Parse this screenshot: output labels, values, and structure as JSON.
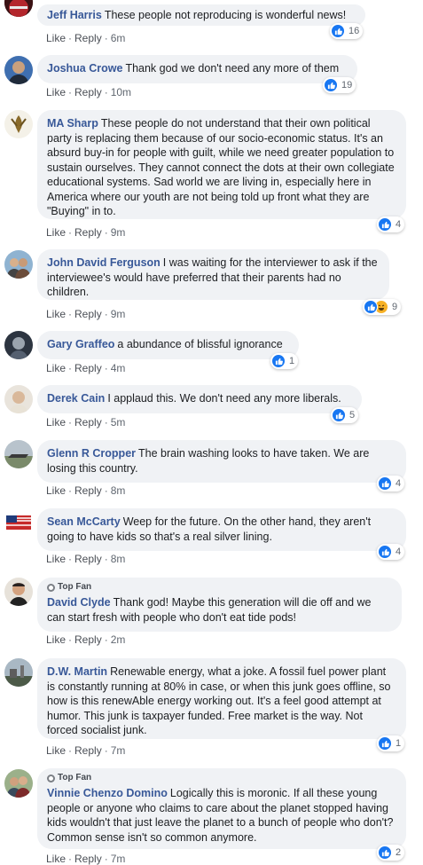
{
  "actions": {
    "like": "Like",
    "reply": "Reply",
    "dot": "·"
  },
  "top_fan_label": "Top Fan",
  "colors": {
    "like_blue": "#1877f2",
    "author_blue": "#385898",
    "bubble_bg": "#f0f2f5",
    "haha_yellow": "#f7b125"
  },
  "comments": [
    {
      "author": "Jeff Harris",
      "text": "These people not reproducing is wonderful news!",
      "time": "6m",
      "reactions": [
        "like-icon"
      ],
      "count": "16"
    },
    {
      "author": "Joshua Crowe",
      "text": "Thank god we don't need any more of them",
      "time": "10m",
      "reactions": [
        "like-icon"
      ],
      "count": "19"
    },
    {
      "author": "MA Sharp",
      "text": "These people do not understand that their own political party is replacing them because of our socio-economic status. It's an absurd buy-in for people with guilt, while we need greater population to sustain ourselves. They cannot connect the dots at their own collegiate educational systems. Sad world we are living in, especially here in America where our youth are not being told up front what they are \"Buying\" in to.",
      "time": "9m",
      "reactions": [
        "like-icon"
      ],
      "count": "4"
    },
    {
      "author": "John David Ferguson",
      "text": "I was waiting for the interviewer to ask if the interviewee's would have preferred that their parents had no children.",
      "time": "9m",
      "reactions": [
        "like-icon",
        "haha-icon"
      ],
      "count": "9"
    },
    {
      "author": "Gary Graffeo",
      "text": "a abundance of blissful ignorance",
      "time": "4m",
      "reactions": [
        "like-icon"
      ],
      "count": "1"
    },
    {
      "author": "Derek Cain",
      "text": "I applaud this. We don't need any more liberals.",
      "time": "5m",
      "reactions": [
        "like-icon"
      ],
      "count": "5"
    },
    {
      "author": "Glenn R Cropper",
      "text": "The brain washing looks to have taken. We are losing this country.",
      "time": "8m",
      "reactions": [
        "like-icon"
      ],
      "count": "4"
    },
    {
      "author": "Sean McCarty",
      "text": "Weep for the future. On the other hand, they aren't going to have kids so that's a real silver lining.",
      "time": "8m",
      "reactions": [
        "like-icon"
      ],
      "count": "4"
    },
    {
      "author": "David Clyde",
      "top_fan": true,
      "text": "Thank god! Maybe this generation will die off and we can start fresh with people who don't eat tide pods!",
      "time": "2m",
      "reactions": [],
      "count": ""
    },
    {
      "author": "D.W. Martin",
      "text": "Renewable energy, what a joke. A fossil fuel power plant is constantly running at 80% in case, or when this junk goes offline, so how is this renewAble energy working out. It's a feel good attempt at humor. This junk is taxpayer funded. Free market is the way. Not forced socialist junk.",
      "time": "7m",
      "reactions": [
        "like-icon"
      ],
      "count": "1"
    },
    {
      "author": "Vinnie Chenzo Domino",
      "top_fan": true,
      "text": "Logically this is moronic. If all these young people or anyone who claims to care about the planet stopped having kids wouldn't that just leave the planet to a bunch of people who don't? Common sense isn't so common anymore.",
      "time": "7m",
      "reactions": [
        "like-icon"
      ],
      "count": "2"
    }
  ]
}
